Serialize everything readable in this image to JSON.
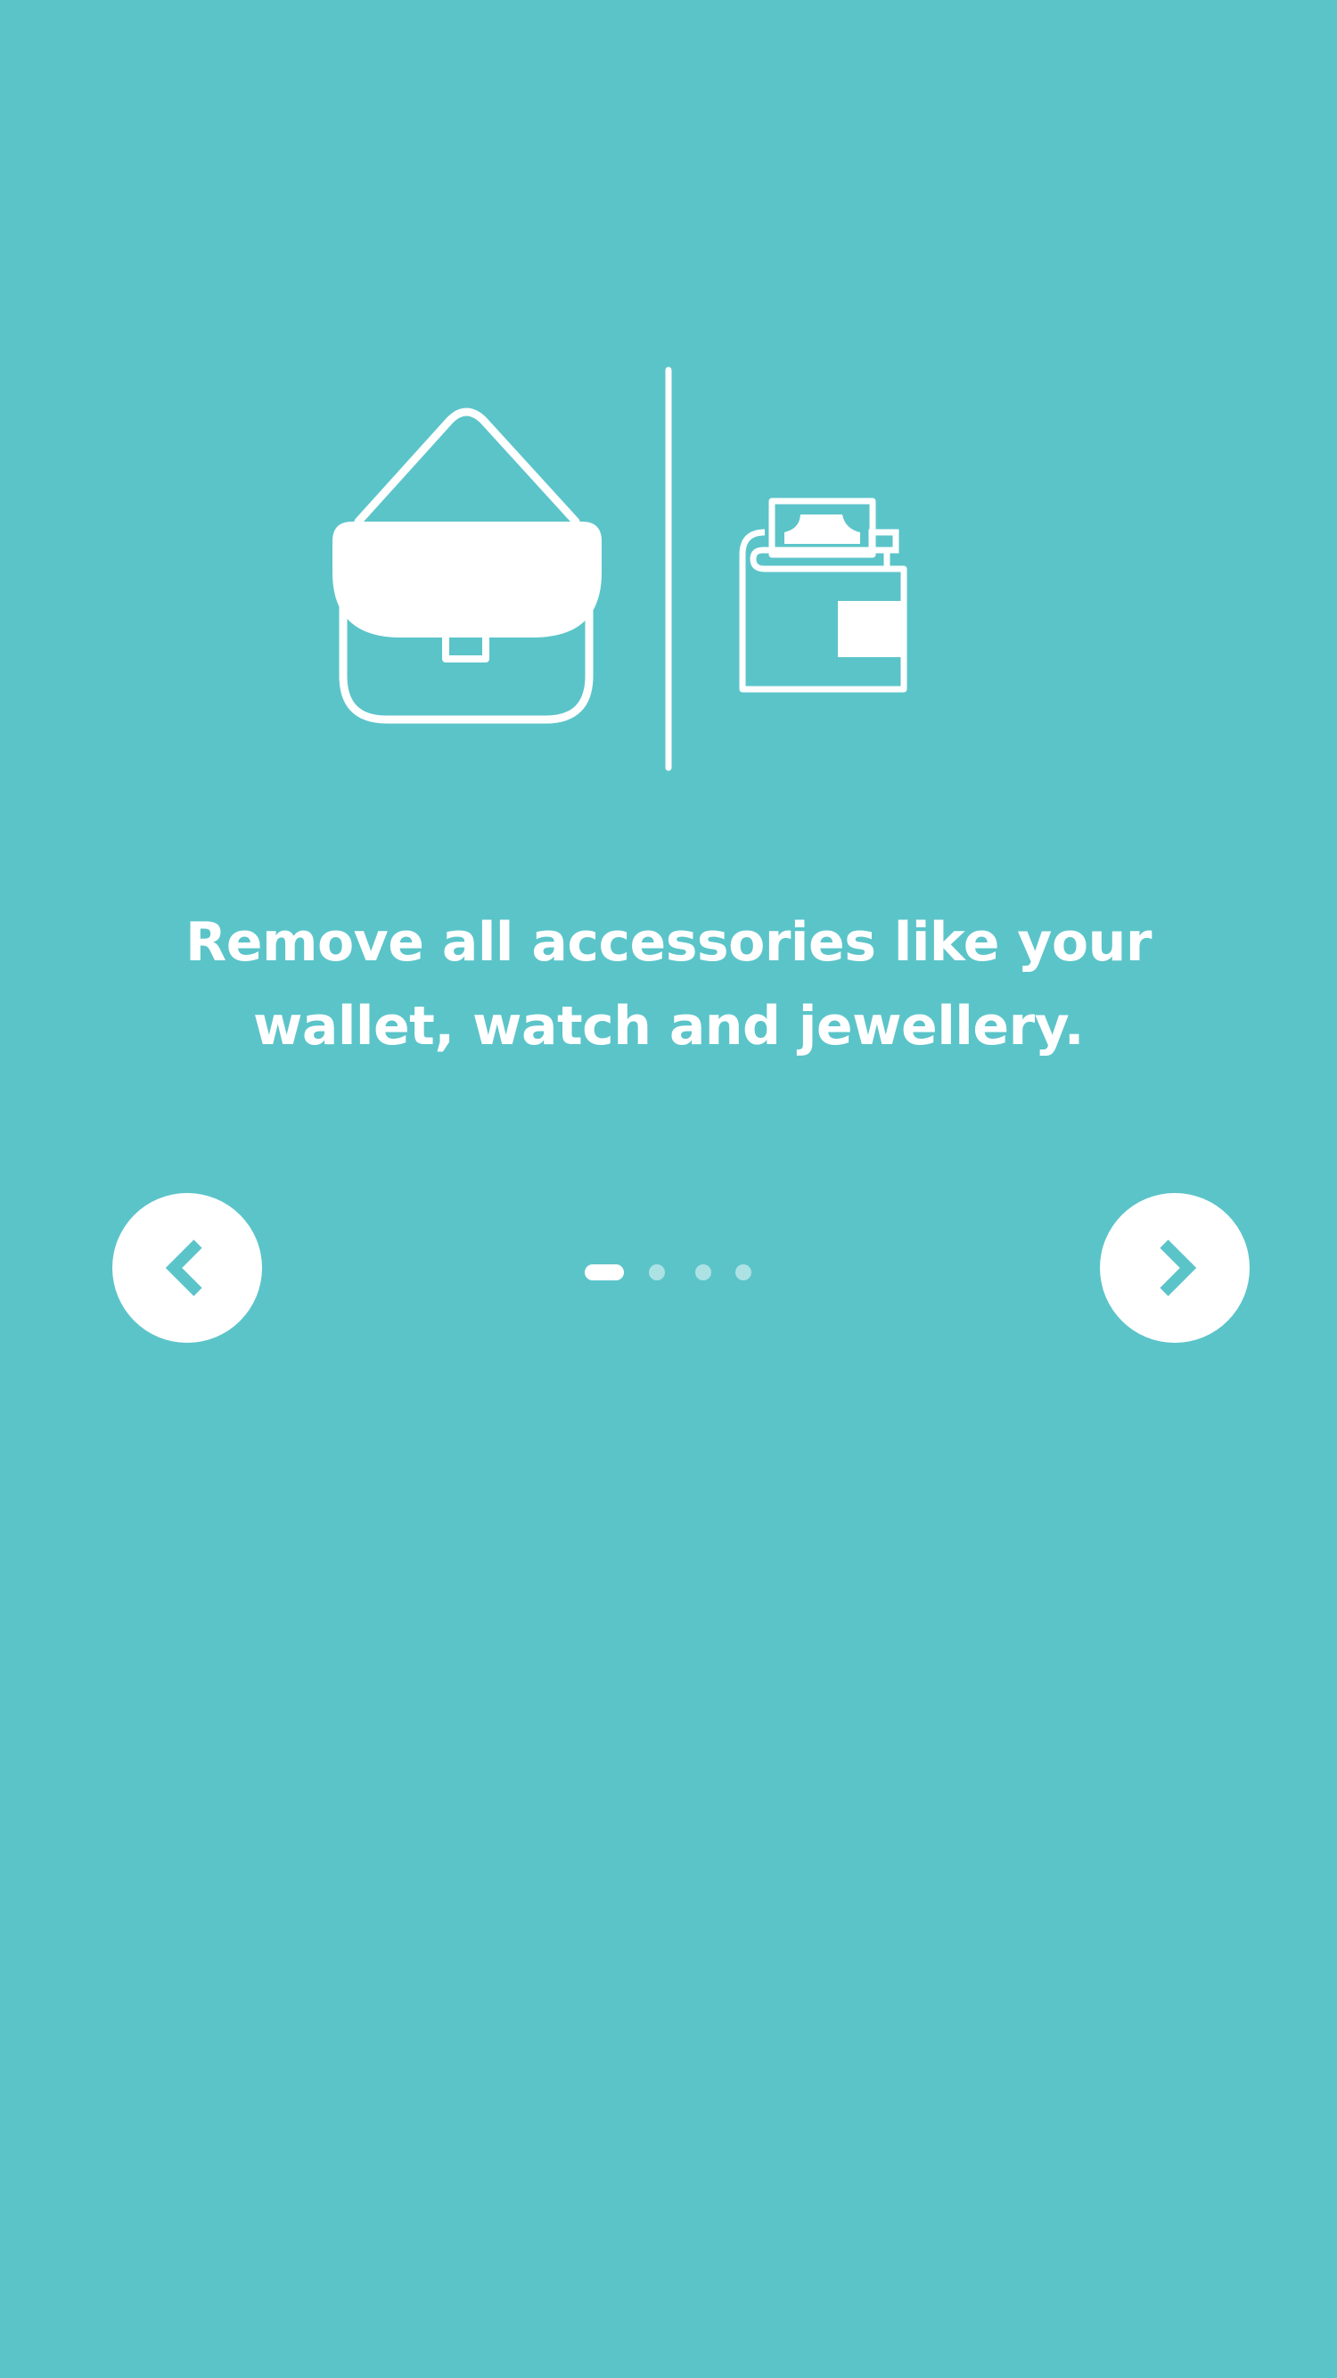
{
  "theme": {
    "background": "#5bc4c9",
    "foreground": "#ffffff"
  },
  "illustration": {
    "icons": [
      "handbag-icon",
      "divider-line",
      "wallet-icon"
    ]
  },
  "instruction": {
    "text": "Remove all accessories like your wallet, watch and jewellery."
  },
  "navigation": {
    "prev_icon": "chevron-left-icon",
    "next_icon": "chevron-right-icon"
  },
  "pagination": {
    "total": 4,
    "current": 1
  }
}
